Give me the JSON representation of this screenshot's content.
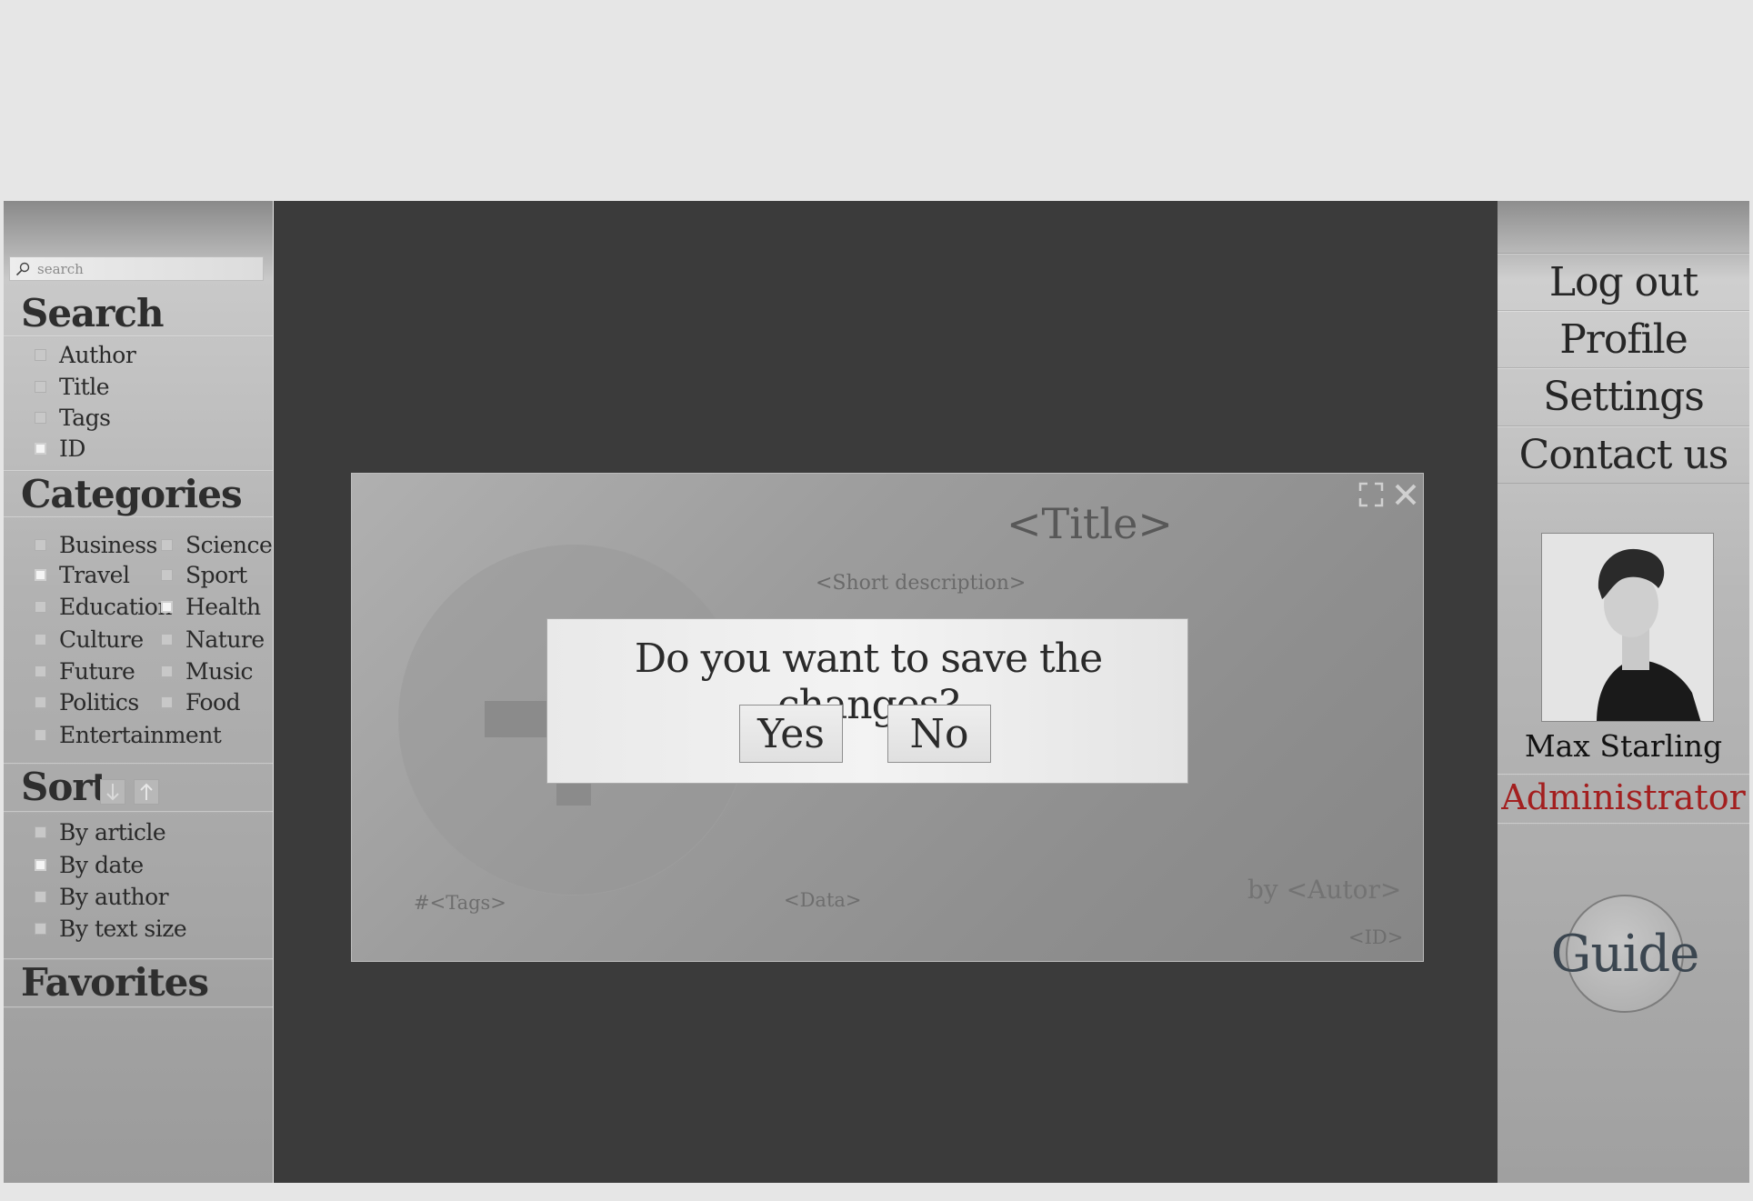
{
  "search": {
    "placeholder": "search"
  },
  "sidebar": {
    "search_title": "Search",
    "search_filters": [
      {
        "label": "Author",
        "checked": false
      },
      {
        "label": "Title",
        "checked": false
      },
      {
        "label": "Tags",
        "checked": false
      },
      {
        "label": "ID",
        "checked": true
      }
    ],
    "categories_title": "Categories",
    "categories": [
      {
        "label": "Business",
        "checked": false
      },
      {
        "label": "Science",
        "checked": false
      },
      {
        "label": "Travel",
        "checked": true
      },
      {
        "label": "Sport",
        "checked": false
      },
      {
        "label": "Education",
        "checked": false
      },
      {
        "label": "Health",
        "checked": true
      },
      {
        "label": "Culture",
        "checked": false
      },
      {
        "label": "Nature",
        "checked": false
      },
      {
        "label": "Future",
        "checked": false
      },
      {
        "label": "Music",
        "checked": false
      },
      {
        "label": "Politics",
        "checked": false
      },
      {
        "label": "Food",
        "checked": false
      },
      {
        "label": "Entertainment",
        "checked": false
      }
    ],
    "sort_title": "Sort",
    "sort_options": [
      {
        "label": "By article",
        "checked": false
      },
      {
        "label": "By date",
        "checked": true
      },
      {
        "label": "By author",
        "checked": false
      },
      {
        "label": "By text size",
        "checked": false
      }
    ],
    "favorites_title": "Favorites"
  },
  "card": {
    "title": "<Title>",
    "short_description": "<Short description>",
    "tags": "#<Tags>",
    "date": "<Data>",
    "author": "by <Autor>",
    "id": "<ID>"
  },
  "dialog": {
    "question": "Do you want to save the changes?",
    "yes_label": "Yes",
    "no_label": "No"
  },
  "menu": {
    "logout": "Log out",
    "profile": "Profile",
    "settings": "Settings",
    "contact": "Contact us"
  },
  "user": {
    "name": "Max Starling",
    "role": "Administrator"
  },
  "guide_label": "Guide",
  "colors": {
    "role_red": "#a31f1f",
    "overlay": "#3b3b3b",
    "page_bg": "#e6e6e6"
  }
}
